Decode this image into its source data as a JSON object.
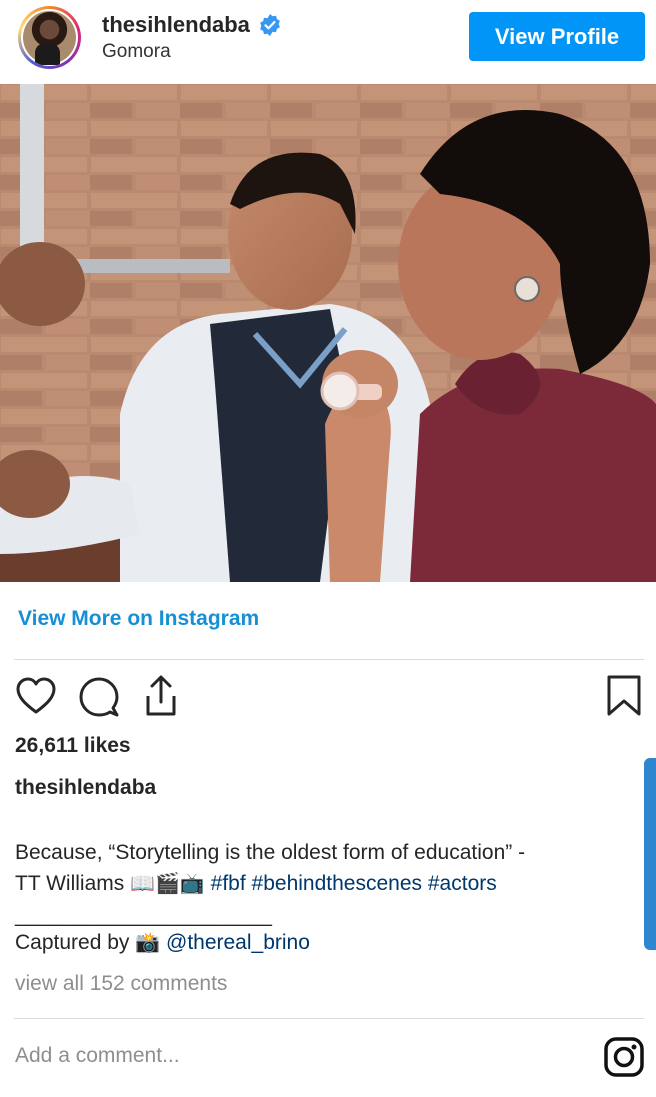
{
  "header": {
    "username": "thesihlendaba",
    "subtitle": "Gomora",
    "view_profile_label": "View Profile",
    "verified_icon": "verified-badge-icon"
  },
  "post": {
    "image_icon": "post-photo",
    "view_more_label": "View More on Instagram",
    "likes": "26,611 likes",
    "caption_username": "thesihlendaba",
    "caption_line1": "Because, “Storytelling is the oldest form of education” -",
    "caption_line2_text": "TT Williams ",
    "caption_emojis": "📖🎬📺",
    "hashtags": [
      "#fbf",
      "#behindthescenes",
      "#actors"
    ],
    "separator": "______________________",
    "captured_by": "Captured by ",
    "camera_emoji": "📸",
    "mention": "@thereal_brino",
    "view_comments": "view all 152 comments",
    "add_comment_placeholder": "Add a comment..."
  },
  "icons": {
    "like": "heart-icon",
    "comment": "comment-icon",
    "share": "share-icon",
    "save": "bookmark-icon",
    "logo": "instagram-logo-icon"
  },
  "colors": {
    "accent": "#0095f6",
    "link": "#1590d6",
    "hashtag": "#00376b",
    "muted": "#8e8e8e"
  }
}
